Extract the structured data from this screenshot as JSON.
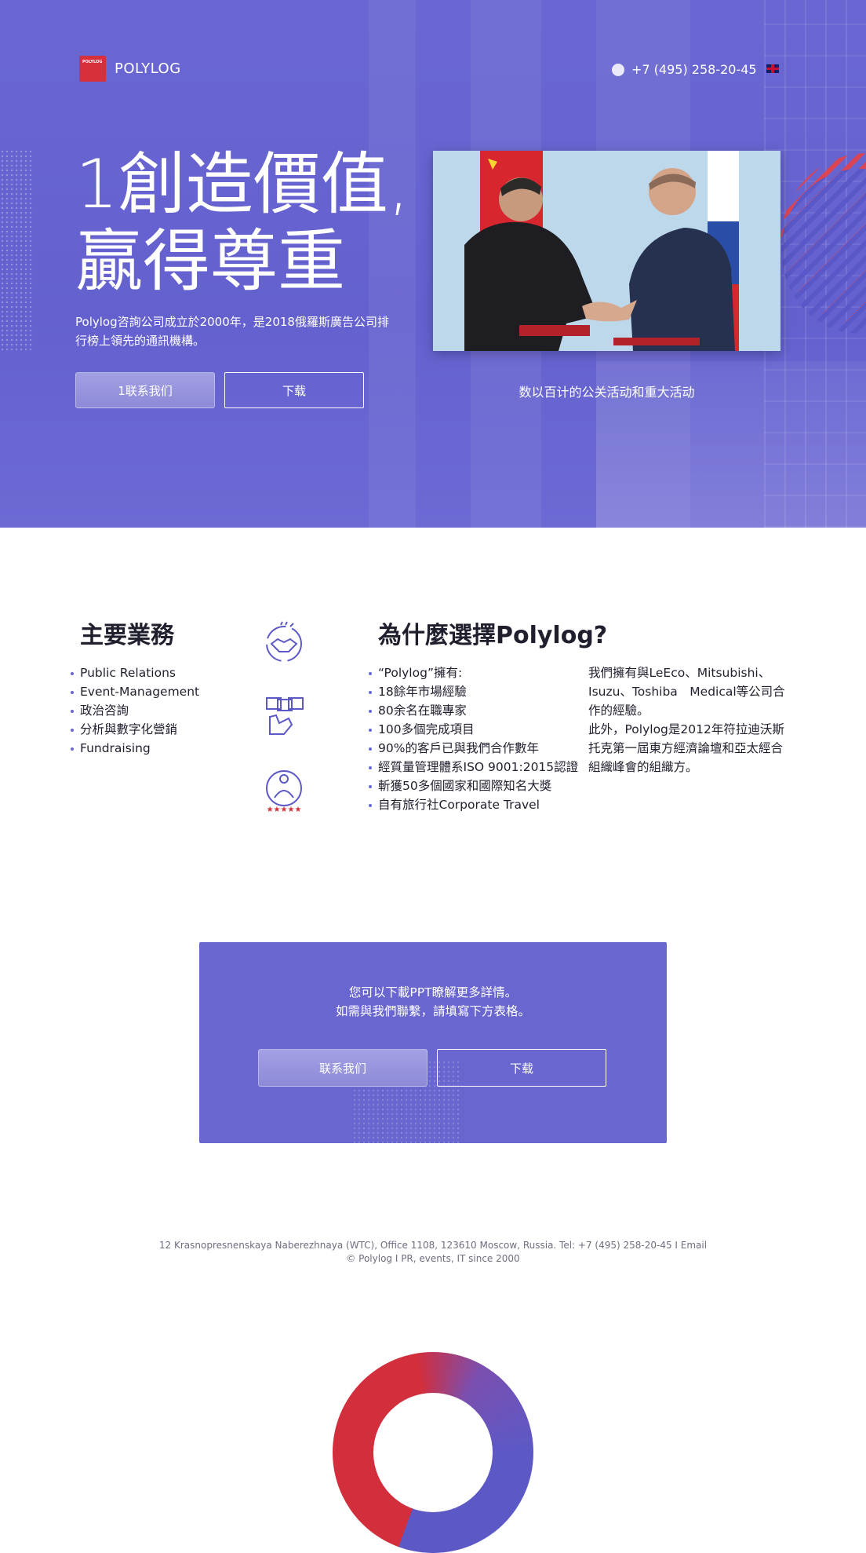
{
  "header": {
    "logo_small": "POLYLOG",
    "logo_text": "POLYLOG",
    "phone": "+7 (495) 258-20-45",
    "phone_icon": "phone-icon",
    "lang_icon": "uk-flag-icon"
  },
  "hero": {
    "headline_line1": "1創造價值,",
    "headline_line2": "贏得尊重",
    "description": "Polylog咨詢公司成立於2000年，是2018俄羅斯廣告公司排行榜上領先的通訊機構。",
    "contact_button": "1联系我们",
    "download_button": "下载",
    "photo_caption": "数以百计的公关活动和重大活动"
  },
  "services": {
    "title": "主要業務",
    "items": [
      "Public Relations",
      "Event-Management",
      "政治咨詢",
      "分析與數字化營銷",
      " Fundraising"
    ],
    "icons": [
      "handshake-icon",
      "hand-cards-icon",
      "person-rating-icon"
    ]
  },
  "why": {
    "title": "為什麼選擇Polylog?",
    "items": [
      "“Polylog”擁有:",
      "18餘年市場經驗",
      "80余名在職專家",
      "100多個完成項目",
      "90%的客戶已與我們合作數年",
      "經質量管理體系ISO 9001:2015認證",
      "斬獲50多個國家和國際知名大獎",
      "自有旅行社Corporate Travel"
    ],
    "paragraph1": "我們擁有與LeEco、Mitsubishi、Isuzu、Toshiba　Medical等公司合作的經驗。",
    "paragraph2": "此外，Polylog是2012年符拉迪沃斯托克第一屆東方經濟論壇和亞太經合組織峰會的組織方。"
  },
  "cta": {
    "line1": "您可以下載PPT瞭解更多詳情。",
    "line2": "如需與我們聯繫，請填寫下方表格。",
    "contact_button": "联系我们",
    "download_button": "下载"
  },
  "footer": {
    "address": "12 Krasnopresnenskaya Naberezhnaya (WTC), Office 1108, 123610 Moscow, Russia.  Tel: +7 (495) 258-20-45 I Email",
    "copyright": "© Polylog I PR, events, IT since 2000"
  },
  "colors": {
    "accent": "#6a67d2",
    "brand_red": "#d63038"
  }
}
